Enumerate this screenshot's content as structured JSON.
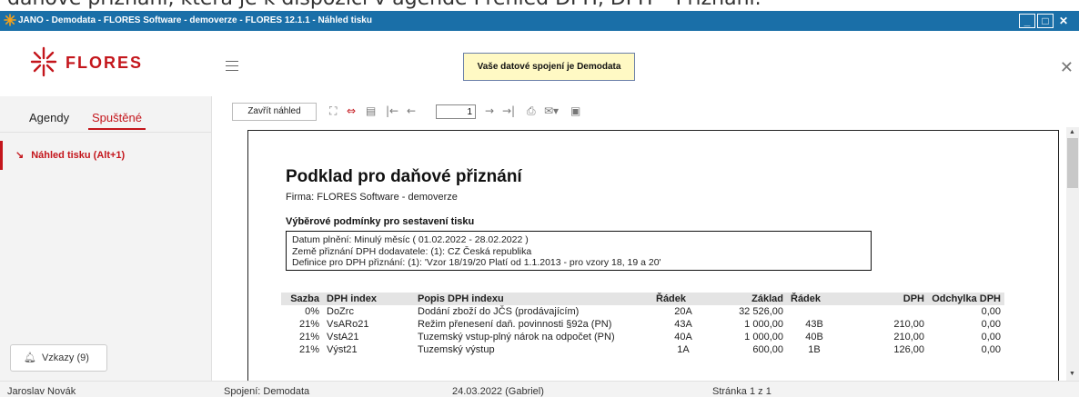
{
  "banner": {
    "text": "daňové přiznání, která je k dispozici v agendě Přehled DPH, DPH – Přiznání."
  },
  "window": {
    "title": "JANO - Demodata - FLORES Software - demoverze - FLORES 12.1.1 - Náhled tisku"
  },
  "header": {
    "logo_text": "FLORES",
    "connection_notice": "Vaše datové spojení je Demodata",
    "close_icon": "close-icon",
    "menu_icon": "hamburger-icon"
  },
  "sidebar": {
    "tabs": [
      {
        "label": "Agendy"
      },
      {
        "label": "Spuštěné"
      }
    ],
    "running_items": [
      {
        "label": "Náhled tisku (Alt+1)"
      }
    ],
    "messages_button": "Vzkazy (9)"
  },
  "toolbar": {
    "close_preview": "Zavřít náhled",
    "page_value": "1",
    "icons": [
      "fullscreen-icon",
      "fit-width-icon",
      "one-page-icon",
      "first-page-icon",
      "prev-page-icon",
      "next-page-icon",
      "last-page-icon",
      "print-icon",
      "email-icon",
      "save-icon"
    ]
  },
  "document": {
    "title": "Podklad pro daňové přiznání",
    "firm": "Firma: FLORES Software - demoverze",
    "conditions_title": "Výběrové podmínky pro sestavení tisku",
    "conditions": [
      "Datum plnění: Minulý měsíc ( 01.02.2022 - 28.02.2022 )",
      "Země přiznání DPH dodavatele: (1): CZ Česká republika",
      "Definice pro DPH přiznání: (1): 'Vzor 18/19/20 Platí od 1.1.2013 - pro vzory 18, 19 a 20'"
    ],
    "columns": [
      "Sazba",
      "DPH index",
      "Popis DPH indexu",
      "Řádek",
      "Základ",
      "Řádek",
      "DPH",
      "Odchylka DPH"
    ],
    "rows": [
      [
        "0%",
        "DoZrc",
        "Dodání zboží do JČS (prodávajícím)",
        "20A",
        "32 526,00",
        "",
        "",
        "0,00"
      ],
      [
        "21%",
        "VsARo21",
        "Režim přenesení daň. povinnosti §92a (PN)",
        "43A",
        "1 000,00",
        "43B",
        "210,00",
        "0,00"
      ],
      [
        "21%",
        "VstA21",
        "Tuzemský vstup-plný nárok na odpočet (PN)",
        "40A",
        "1 000,00",
        "40B",
        "210,00",
        "0,00"
      ],
      [
        "21%",
        "Výst21",
        "Tuzemský výstup",
        "1A",
        "600,00",
        "1B",
        "126,00",
        "0,00"
      ]
    ]
  },
  "statusbar": {
    "user": "Jaroslav Novák",
    "connection": "Spojení: Demodata",
    "date": "24.03.2022 (Gabriel)",
    "page": "Stránka 1 z 1"
  },
  "colors": {
    "titlebar": "#1a6fa8",
    "accent": "#c4161c",
    "notice_bg": "#fff9c4"
  }
}
